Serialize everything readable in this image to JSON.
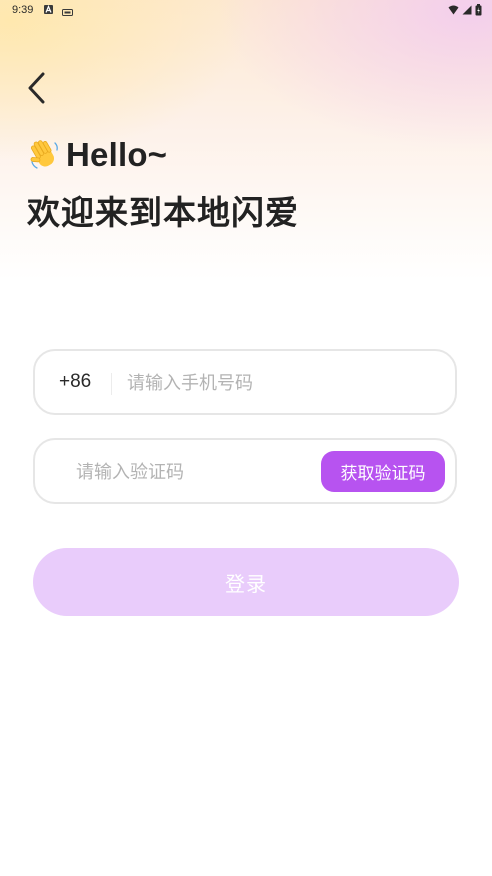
{
  "status_bar": {
    "time": "9:39",
    "icons": [
      "a-notification-icon",
      "app-notification-icon",
      "wifi-icon",
      "signal-icon",
      "battery-icon"
    ]
  },
  "header": {
    "back_icon": "chevron-left-icon",
    "wave_icon": "waving-hand-icon",
    "hello": "Hello~",
    "welcome": "欢迎来到本地闪爱"
  },
  "phone_field": {
    "country_code": "+86",
    "placeholder": "请输入手机号码",
    "value": ""
  },
  "code_field": {
    "placeholder": "请输入验证码",
    "value": "",
    "get_code_label": "获取验证码"
  },
  "login": {
    "label": "登录"
  },
  "colors": {
    "accent": "#b753f0",
    "login_disabled": "#e9ccfb",
    "text": "#222222",
    "placeholder": "#b3b3b3"
  }
}
